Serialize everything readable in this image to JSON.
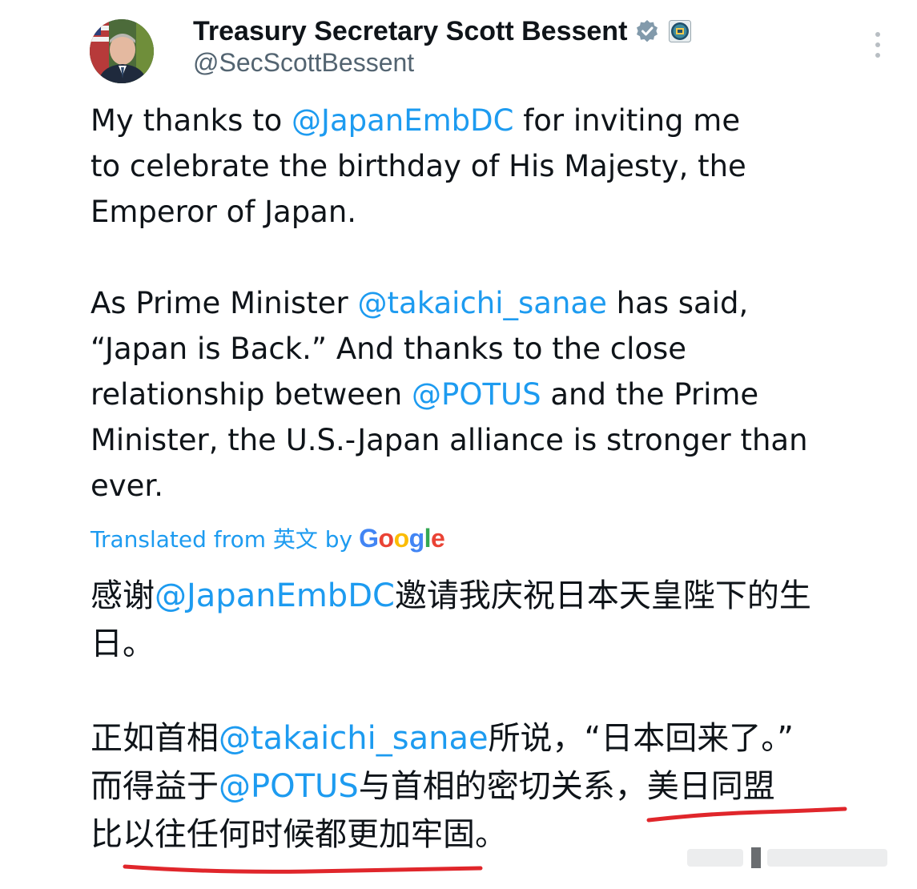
{
  "tweet": {
    "author_name": "Treasury Secretary Scott Bessent",
    "handle": "@SecScottBessent",
    "original_paragraph_1": [
      [
        "My thanks to ",
        "@JapanEmbDC",
        " for inviting me"
      ],
      [
        "to celebrate the birthday of His Majesty, the"
      ],
      [
        "Emperor of Japan."
      ]
    ],
    "original_paragraph_2": [
      [
        "As Prime Minister ",
        "@takaichi_sanae",
        " has said,"
      ],
      [
        "“Japan is Back.” And thanks to the close"
      ],
      [
        "relationship between ",
        "@POTUS",
        " and the Prime"
      ],
      [
        "Minister, the U.S.-Japan alliance is stronger than"
      ],
      [
        "ever."
      ]
    ],
    "translation_label": "Translated from 英文 by",
    "translation_provider": "Google",
    "translated_paragraph_1": [
      [
        "感谢",
        "@JapanEmbDC",
        "邀请我庆祝日本天皇陛下的生"
      ],
      [
        "日。"
      ]
    ],
    "translated_paragraph_2": [
      [
        "正如首相",
        "@takaichi_sanae",
        "所说，“日本回来了。”"
      ],
      [
        "而得益于",
        "@POTUS",
        "与首相的密切关系，美日同盟"
      ],
      [
        "比以往任何时候都更加牢固。"
      ]
    ]
  },
  "icons": {
    "verified": "verified-badge-icon",
    "affiliation": "treasury-seal-icon",
    "more": "more-options-icon"
  },
  "colors": {
    "mention": "#1d9bf0",
    "secondary_text": "#536471",
    "primary_text": "#0f1419",
    "annotation_underline": "#e0262b"
  }
}
